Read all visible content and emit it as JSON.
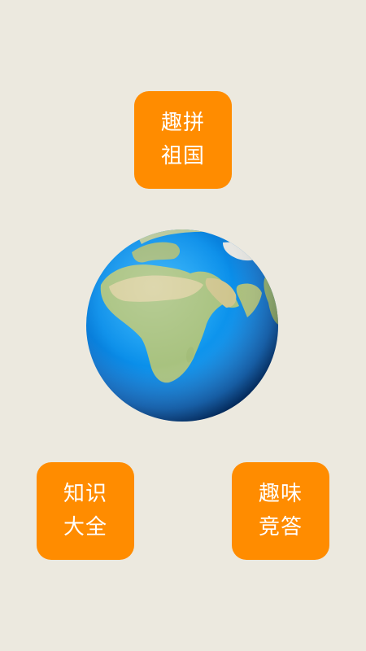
{
  "menu": {
    "top": {
      "line1": "趣拼",
      "line2": "祖国"
    },
    "left": {
      "line1": "知识",
      "line2": "大全"
    },
    "right": {
      "line1": "趣味",
      "line2": "竞答"
    }
  },
  "colors": {
    "background": "#ECE9DF",
    "tile": "#FF8C00",
    "tile_text": "#FFFFFF",
    "ocean": "#0A80E0",
    "land": "#A7C27E"
  },
  "globe": {
    "icon": "earth-globe-icon"
  }
}
